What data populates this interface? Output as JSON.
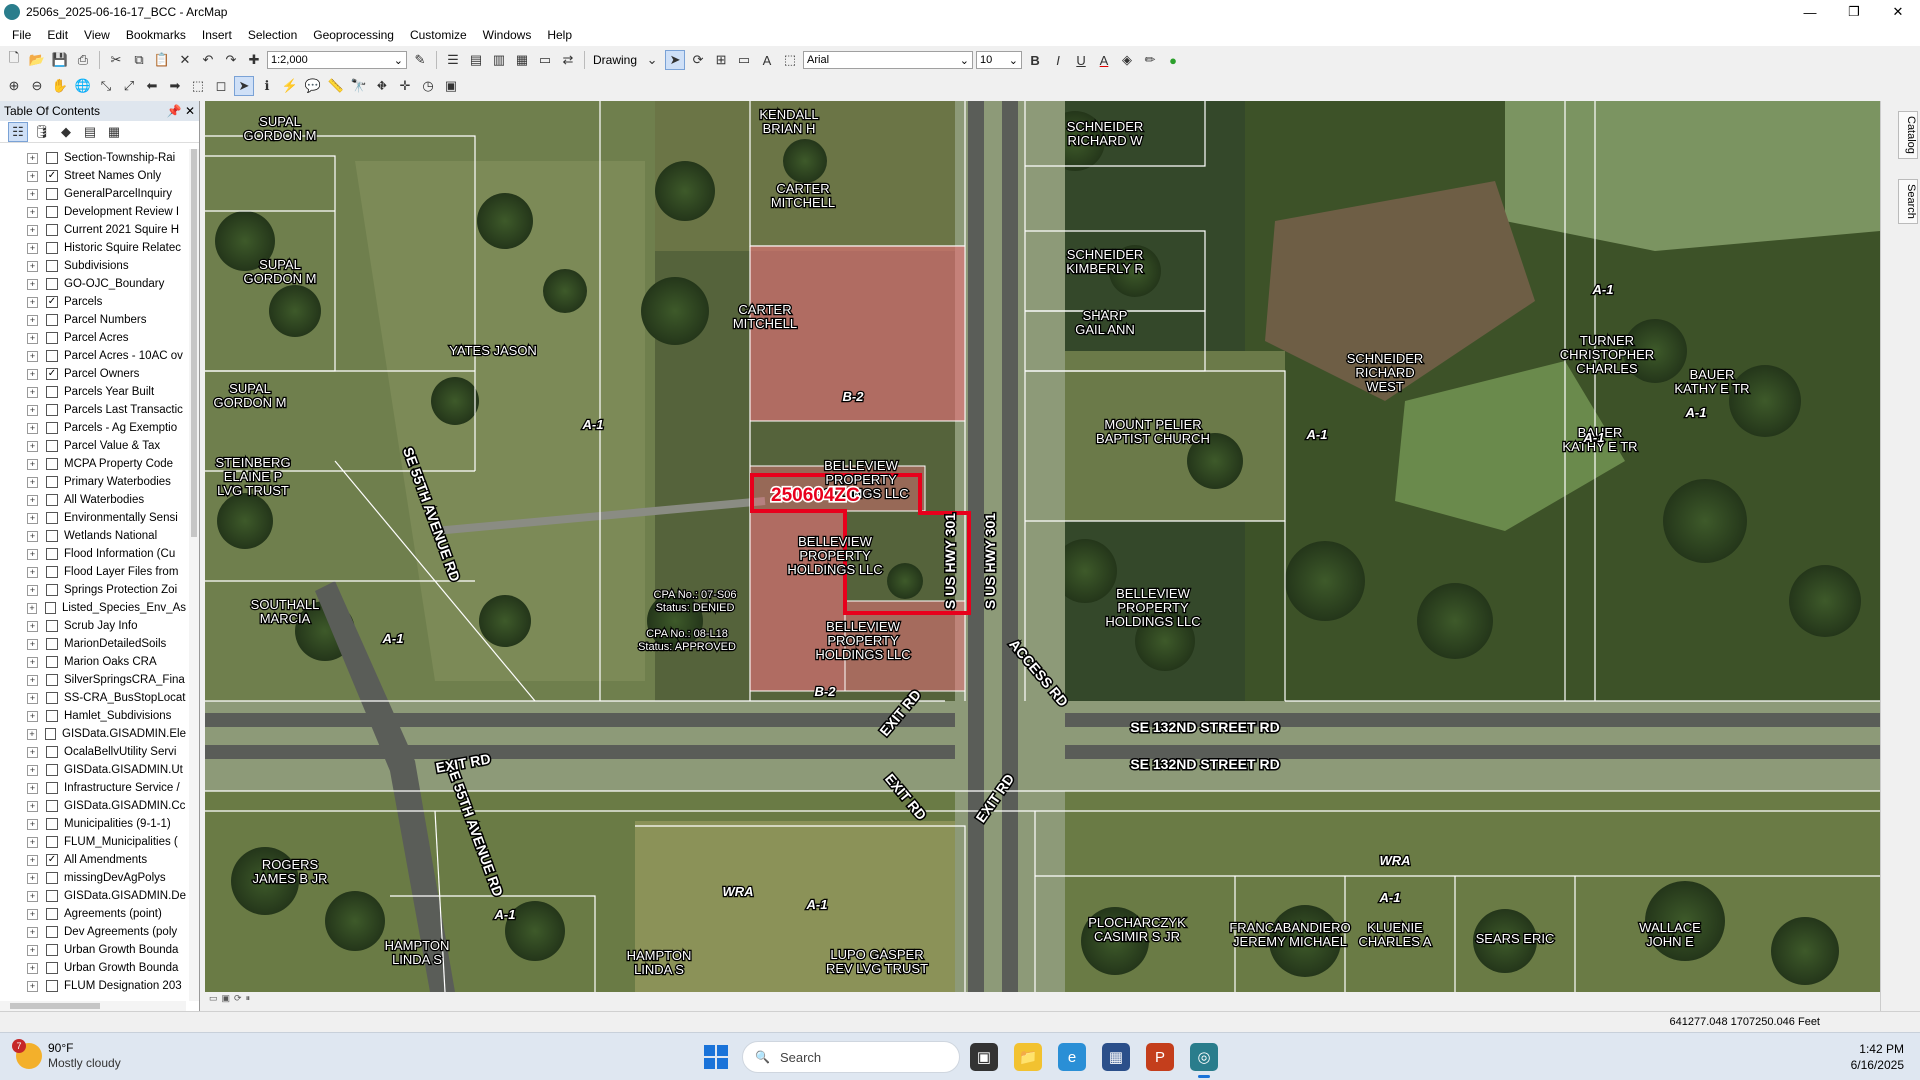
{
  "window": {
    "title": "2506s_2025-06-16-17_BCC - ArcMap",
    "minimize": "—",
    "maximize": "❐",
    "close": "✕"
  },
  "menu": [
    "File",
    "Edit",
    "View",
    "Bookmarks",
    "Insert",
    "Selection",
    "Geoprocessing",
    "Customize",
    "Windows",
    "Help"
  ],
  "toolbar": {
    "scale": "1:2,000",
    "drawing_label": "Drawing",
    "font_name": "Arial",
    "font_size": "10",
    "bold": "B",
    "italic": "I",
    "underline": "U",
    "font_color_letter": "A"
  },
  "toc": {
    "title": "Table Of Contents",
    "layers": [
      {
        "name": "Section-Township-Rai",
        "checked": false
      },
      {
        "name": "Street Names Only",
        "checked": true
      },
      {
        "name": "GeneralParcelInquiry",
        "checked": false
      },
      {
        "name": "Development Review I",
        "checked": false
      },
      {
        "name": "Current 2021 Squire H",
        "checked": false
      },
      {
        "name": "Historic Squire Relatec",
        "checked": false
      },
      {
        "name": "Subdivisions",
        "checked": false
      },
      {
        "name": "GO-OJC_Boundary",
        "checked": false
      },
      {
        "name": "Parcels",
        "checked": true
      },
      {
        "name": "Parcel Numbers",
        "checked": false
      },
      {
        "name": "Parcel Acres",
        "checked": false
      },
      {
        "name": "Parcel Acres - 10AC ov",
        "checked": false
      },
      {
        "name": "Parcel Owners",
        "checked": true
      },
      {
        "name": "Parcels Year Built",
        "checked": false
      },
      {
        "name": "Parcels Last Transactic",
        "checked": false
      },
      {
        "name": "Parcels - Ag Exemptio",
        "checked": false
      },
      {
        "name": "Parcel Value & Tax",
        "checked": false
      },
      {
        "name": "MCPA Property Code",
        "checked": false
      },
      {
        "name": "Primary Waterbodies",
        "checked": false
      },
      {
        "name": "All Waterbodies",
        "checked": false
      },
      {
        "name": "Environmentally Sensi",
        "checked": false
      },
      {
        "name": "Wetlands National",
        "checked": false
      },
      {
        "name": "Flood Information (Cu",
        "checked": false
      },
      {
        "name": "Flood Layer Files from",
        "checked": false
      },
      {
        "name": "Springs Protection Zoi",
        "checked": false
      },
      {
        "name": "Listed_Species_Env_As",
        "checked": false
      },
      {
        "name": "Scrub Jay Info",
        "checked": false
      },
      {
        "name": "MarionDetailedSoils",
        "checked": false
      },
      {
        "name": "Marion Oaks CRA",
        "checked": false
      },
      {
        "name": "SilverSpringsCRA_Fina",
        "checked": false
      },
      {
        "name": "SS-CRA_BusStopLocat",
        "checked": false
      },
      {
        "name": "Hamlet_Subdivisions",
        "checked": false
      },
      {
        "name": "GISData.GISADMIN.Ele",
        "checked": false
      },
      {
        "name": "OcalaBellvUtility Servi",
        "checked": false
      },
      {
        "name": "GISData.GISADMIN.Ut",
        "checked": false
      },
      {
        "name": "Infrastructure Service /",
        "checked": false
      },
      {
        "name": "GISData.GISADMIN.Cc",
        "checked": false
      },
      {
        "name": "Municipalities (9-1-1)",
        "checked": false
      },
      {
        "name": "FLUM_Municipalities (",
        "checked": false
      },
      {
        "name": "All Amendments",
        "checked": true
      },
      {
        "name": "missingDevAgPolys",
        "checked": false
      },
      {
        "name": "GISData.GISADMIN.De",
        "checked": false
      },
      {
        "name": "Agreements (point)",
        "checked": false
      },
      {
        "name": "Dev Agreements (poly",
        "checked": false
      },
      {
        "name": "Urban Growth Bounda",
        "checked": false
      },
      {
        "name": "Urban Growth Bounda",
        "checked": false
      },
      {
        "name": "FLUM Designation 203",
        "checked": false
      }
    ]
  },
  "map": {
    "case_label": "250604ZC",
    "labels": [
      {
        "key": "kendall",
        "lines": [
          "KENDALL",
          "BRIAN H"
        ]
      },
      {
        "key": "carter1",
        "lines": [
          "CARTER",
          "MITCHELL"
        ]
      },
      {
        "key": "carter2",
        "lines": [
          "CARTER",
          "MITCHELL"
        ]
      },
      {
        "key": "supal1",
        "lines": [
          "SUPAL",
          "GORDON M"
        ]
      },
      {
        "key": "supal2",
        "lines": [
          "SUPAL",
          "GORDON M"
        ]
      },
      {
        "key": "supal3",
        "lines": [
          "SUPAL",
          "GORDON M"
        ]
      },
      {
        "key": "yates",
        "lines": [
          "YATES JASON"
        ]
      },
      {
        "key": "steinberg",
        "lines": [
          "STEINBERG",
          "ELAINE P",
          "LVG TRUST"
        ]
      },
      {
        "key": "southall",
        "lines": [
          "SOUTHALL",
          "MARCIA"
        ]
      },
      {
        "key": "schneider_rw",
        "lines": [
          "SCHNEIDER",
          "RICHARD W"
        ]
      },
      {
        "key": "schneider_kr",
        "lines": [
          "SCHNEIDER",
          "KIMBERLY R"
        ]
      },
      {
        "key": "sharp",
        "lines": [
          "SHARP",
          "GAIL ANN"
        ]
      },
      {
        "key": "mount_pelier",
        "lines": [
          "MOUNT PELIER",
          "BAPTIST CHURCH"
        ]
      },
      {
        "key": "belleview1",
        "lines": [
          "BELLEVIEW",
          "PROPERTY",
          "HOLDINGS LLC"
        ]
      },
      {
        "key": "belleview2",
        "lines": [
          "BELLEVIEW",
          "PROPERTY",
          "HOLDINGS LLC"
        ]
      },
      {
        "key": "belleview3",
        "lines": [
          "BELLEVIEW",
          "PROPERTY",
          "HOLDINGS LLC"
        ]
      },
      {
        "key": "belleview4",
        "lines": [
          "BELLEVIEW",
          "PROPERTY",
          "HOLDINGS LLC"
        ]
      },
      {
        "key": "schneider_rww",
        "lines": [
          "SCHNEIDER",
          "RICHARD",
          "WEST"
        ]
      },
      {
        "key": "turner",
        "lines": [
          "TURNER",
          "CHRISTOPHER",
          "CHARLES"
        ]
      },
      {
        "key": "bauer1",
        "lines": [
          "BAUER",
          "KATHY E TR"
        ]
      },
      {
        "key": "bauer2",
        "lines": [
          "BAUER",
          "KATHY E TR"
        ]
      },
      {
        "key": "cpa1",
        "lines": [
          "CPA No.: 07-S06",
          "Status: DENIED"
        ]
      },
      {
        "key": "cpa2",
        "lines": [
          "CPA No.: 08-L18",
          "Status: APPROVED"
        ]
      },
      {
        "key": "rogers",
        "lines": [
          "ROGERS",
          "JAMES B JR"
        ]
      },
      {
        "key": "hampton1",
        "lines": [
          "HAMPTON",
          "LINDA S"
        ]
      },
      {
        "key": "hampton2",
        "lines": [
          "HAMPTON",
          "LINDA S"
        ]
      },
      {
        "key": "lupo",
        "lines": [
          "LUPO GASPER",
          "REV LVG TRUST"
        ]
      },
      {
        "key": "plocharczyk",
        "lines": [
          "PLOCHARCZYK",
          "CASIMIR S JR"
        ]
      },
      {
        "key": "francabandiero",
        "lines": [
          "FRANCABANDIERO",
          "JEREMY MICHAEL"
        ]
      },
      {
        "key": "kluenie",
        "lines": [
          "KLUENIE",
          "CHARLES A"
        ]
      },
      {
        "key": "sears",
        "lines": [
          "SEARS ERIC"
        ]
      },
      {
        "key": "wallace",
        "lines": [
          "WALLACE",
          "JOHN E"
        ]
      }
    ],
    "zoning": [
      {
        "key": "b2a",
        "text": "B-2"
      },
      {
        "key": "b2b",
        "text": "B-2"
      },
      {
        "key": "a1a",
        "text": "A-1"
      },
      {
        "key": "a1b",
        "text": "A-1"
      },
      {
        "key": "a1c",
        "text": "A-1"
      },
      {
        "key": "a1d",
        "text": "A-1"
      },
      {
        "key": "a1e",
        "text": "A-1"
      },
      {
        "key": "a1f",
        "text": "A-1"
      },
      {
        "key": "a1g",
        "text": "A-1"
      },
      {
        "key": "a1h",
        "text": "A-1"
      },
      {
        "key": "a1i",
        "text": "A-1"
      },
      {
        "key": "wra1",
        "text": "WRA"
      },
      {
        "key": "wra2",
        "text": "WRA"
      }
    ],
    "roads": [
      {
        "key": "us301a",
        "text": "S US HWY 301"
      },
      {
        "key": "us301b",
        "text": "S US HWY 301"
      },
      {
        "key": "se55a",
        "text": "SE 55TH AVENUE RD"
      },
      {
        "key": "se55b",
        "text": "SE 55TH AVENUE RD"
      },
      {
        "key": "se132a",
        "text": "SE 132ND STREET RD"
      },
      {
        "key": "se132b",
        "text": "SE 132ND STREET RD"
      },
      {
        "key": "exit1",
        "text": "EXIT RD"
      },
      {
        "key": "exit2",
        "text": "EXIT RD"
      },
      {
        "key": "exit3",
        "text": "EXIT RD"
      },
      {
        "key": "exit4",
        "text": "EXIT RD"
      },
      {
        "key": "access",
        "text": "ACCESS RD"
      }
    ]
  },
  "dock": {
    "catalog": "Catalog",
    "search": "Search"
  },
  "status": {
    "coords": "641277.048  1707250.046 Feet"
  },
  "taskbar": {
    "weather_badge": "7",
    "temperature": "90°F",
    "condition": "Mostly cloudy",
    "search_placeholder": "Search",
    "time": "1:42 PM",
    "date": "6/16/2025"
  },
  "colors": {
    "case_outline": "#e8001c",
    "parcel_fill": "#e8727a",
    "parcel_line": "#ffffff"
  }
}
